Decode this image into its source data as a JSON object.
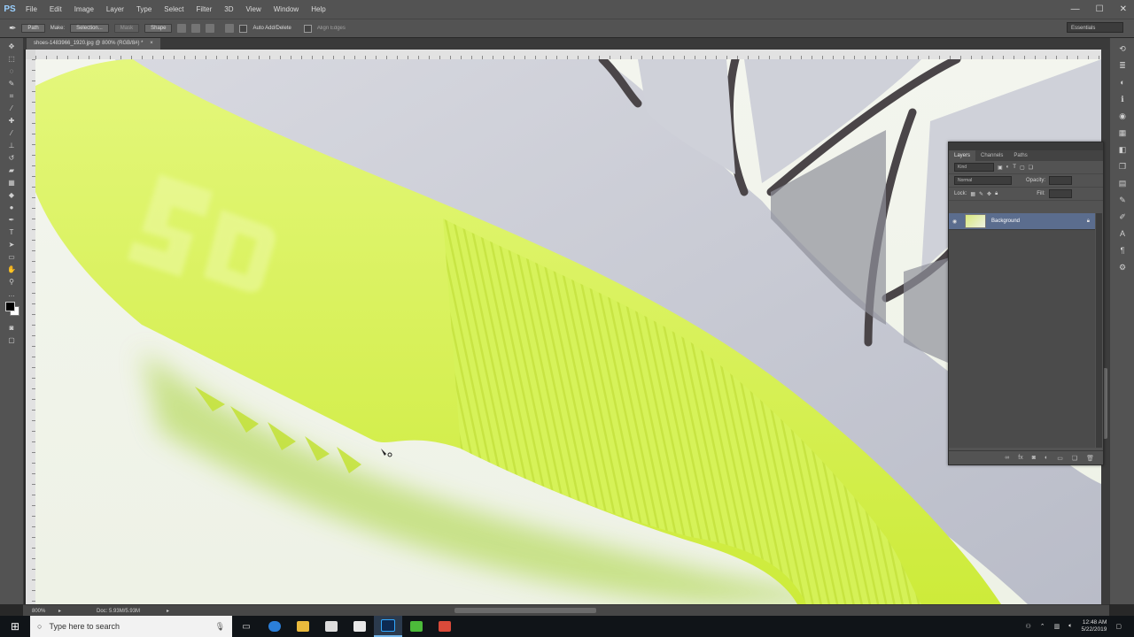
{
  "app": {
    "logo": "PS"
  },
  "menu": [
    "File",
    "Edit",
    "Image",
    "Layer",
    "Type",
    "Select",
    "Filter",
    "3D",
    "View",
    "Window",
    "Help"
  ],
  "window_controls": [
    "—",
    "☐",
    "✕"
  ],
  "options": {
    "tool_mode": "Path",
    "make_label": "Make:",
    "make_selection": "Selection...",
    "mask_btn": "Mask",
    "shape_btn": "Shape",
    "auto_add_delete": "Auto Add/Delete",
    "align_edges": "Align Edges",
    "workspace": "Essentials"
  },
  "document": {
    "tab_title": "shoes-1483966_1920.jpg @ 800% (RGB/8#) *",
    "zoom": "800%",
    "doc_size": "Doc: 5.93M/5.93M"
  },
  "layers_panel": {
    "tabs": [
      "Layers",
      "Channels",
      "Paths"
    ],
    "kind_filter": "Kind",
    "blend_mode": "Normal",
    "opacity_label": "Opacity:",
    "lock_label": "Lock:",
    "fill_label": "Fill:",
    "layer_name": "Background",
    "footer_icons": [
      "link-icon",
      "fx-icon",
      "mask-icon",
      "adjustment-icon",
      "group-icon",
      "new-layer-icon",
      "trash-icon"
    ]
  },
  "taskbar": {
    "search_placeholder": "Type here to search",
    "time": "12:48 AM",
    "date": "5/22/2019",
    "apps": [
      "task-view-icon",
      "edge-icon",
      "file-explorer-icon",
      "store-icon",
      "mail-icon",
      "photoshop-icon",
      "green-app-icon",
      "red-app-icon"
    ]
  },
  "colors": {
    "ui_dark": "#535353",
    "sole_lime": "#d9f25c",
    "upper_gray": "#c7c9d2",
    "lace_dark": "#4a4548",
    "selected_layer": "#5b6d8e"
  }
}
